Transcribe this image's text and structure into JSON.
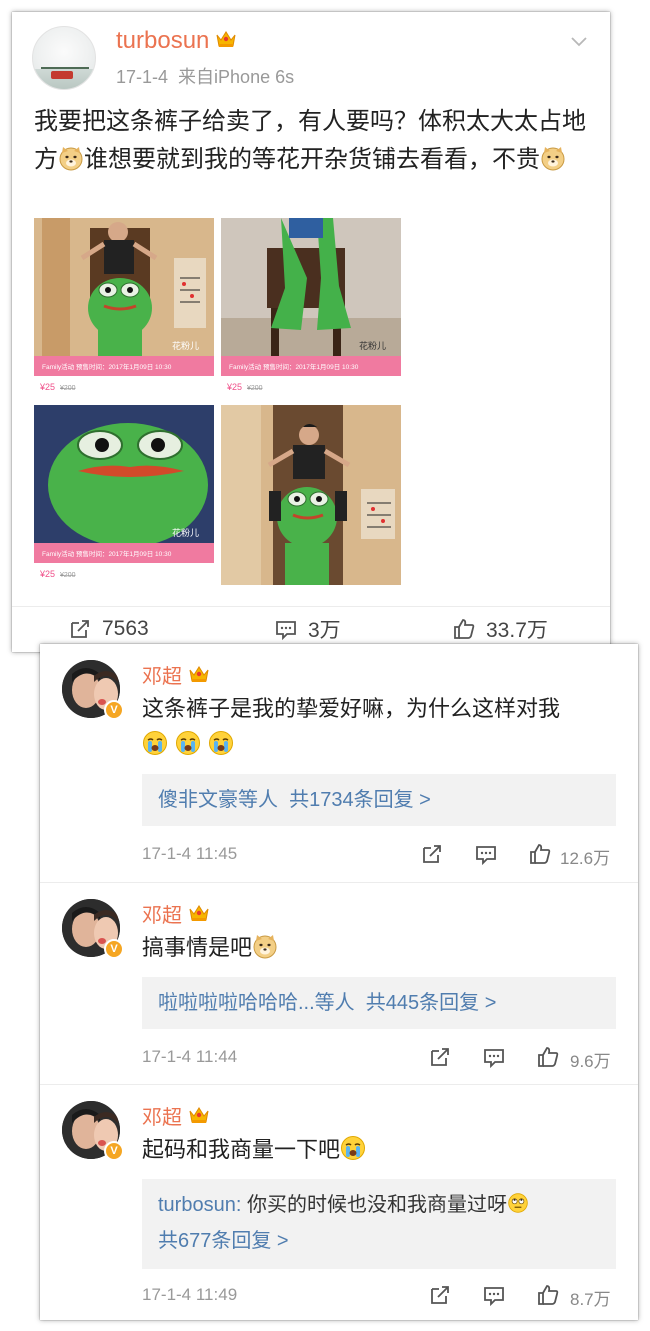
{
  "post": {
    "username": "turbosun",
    "date": "17-1-4",
    "source": "来自iPhone 6s",
    "text_1": "我要把这条裤子给卖了，有人要吗？体积太大太占地方",
    "text_2": "谁想要就到我的等花开杂货铺去看看，不贵",
    "photos": [
      {
        "watermark": "花粉儿",
        "promo": "Family活动 预售时间：2017年1月09日 10:30",
        "price": "¥25",
        "old_price": "¥200"
      },
      {
        "watermark": "花粉儿",
        "promo": "Family活动 预售时间：2017年1月09日 10:30",
        "price": "¥25",
        "old_price": "¥200"
      },
      {
        "watermark": "花粉儿",
        "promo": "Family活动 预售时间：2017年1月09日 10:30",
        "price": "¥25",
        "old_price": "¥200"
      },
      {
        "watermark": "",
        "promo": "",
        "price": "",
        "old_price": ""
      }
    ],
    "actions": {
      "reposts": "7563",
      "comments": "3万",
      "likes": "33.7万"
    }
  },
  "comments": [
    {
      "name": "邓超",
      "text": "这条裤子是我的挚爱好嘛，为什么这样对我",
      "emoji": [
        "crying-icon",
        "crying-icon",
        "crying-icon"
      ],
      "reply_prefix": "傻非文豪等人",
      "reply_count": "共1734条回复 >",
      "time": "17-1-4 11:45",
      "likes": "12.6万"
    },
    {
      "name": "邓超",
      "text": "搞事情是吧",
      "emoji": [
        "doge-icon"
      ],
      "reply_prefix": "啦啦啦啦哈哈哈...等人",
      "reply_count": "共445条回复 >",
      "time": "17-1-4 11:44",
      "likes": "9.6万"
    },
    {
      "name": "邓超",
      "text": "起码和我商量一下吧",
      "emoji": [
        "crying-icon"
      ],
      "reply_user": "turbosun:",
      "reply_text": "你买的时候也没和我商量过呀",
      "reply_count": "共677条回复 >",
      "time": "17-1-4 11:49",
      "likes": "8.7万"
    }
  ],
  "colors": {
    "username": "#eb7350",
    "link": "#507daf",
    "muted": "#999999",
    "badge": "#f5a623"
  }
}
